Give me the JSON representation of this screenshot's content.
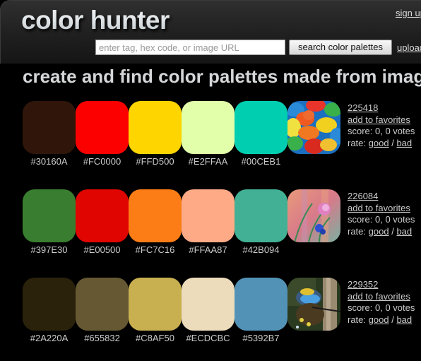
{
  "header": {
    "logo": "color hunter",
    "signup_label": "sign up",
    "search_placeholder": "enter tag, hex code, or image URL",
    "search_value": "",
    "search_button_label": "search color palettes",
    "upload_label": "upload"
  },
  "tagline": "create and find color palettes made from images",
  "palettes": [
    {
      "id": "225418",
      "favorites_label": "add to favorites",
      "score_text": "score: 0, 0 votes",
      "rate_label": "rate:",
      "good_label": "good",
      "separator": "/",
      "bad_label": "bad",
      "image_subject": "candy-thumbnail",
      "colors": [
        "#30160A",
        "#FC0000",
        "#FFD500",
        "#E2FFAA",
        "#00CEB1"
      ]
    },
    {
      "id": "226084",
      "favorites_label": "add to favorites",
      "score_text": "score: 0, 0 votes",
      "rate_label": "rate:",
      "good_label": "good",
      "separator": "/",
      "bad_label": "bad",
      "image_subject": "flowers-thumbnail",
      "colors": [
        "#397E30",
        "#E00500",
        "#FC7C16",
        "#FFAA87",
        "#42B094"
      ]
    },
    {
      "id": "229352",
      "favorites_label": "add to favorites",
      "score_text": "score: 0, 0 votes",
      "rate_label": "rate:",
      "good_label": "good",
      "separator": "/",
      "bad_label": "bad",
      "image_subject": "dragonfly-thumbnail",
      "colors": [
        "#2A220A",
        "#655832",
        "#C8AF50",
        "#ECDCBC",
        "#5392B7"
      ]
    }
  ]
}
